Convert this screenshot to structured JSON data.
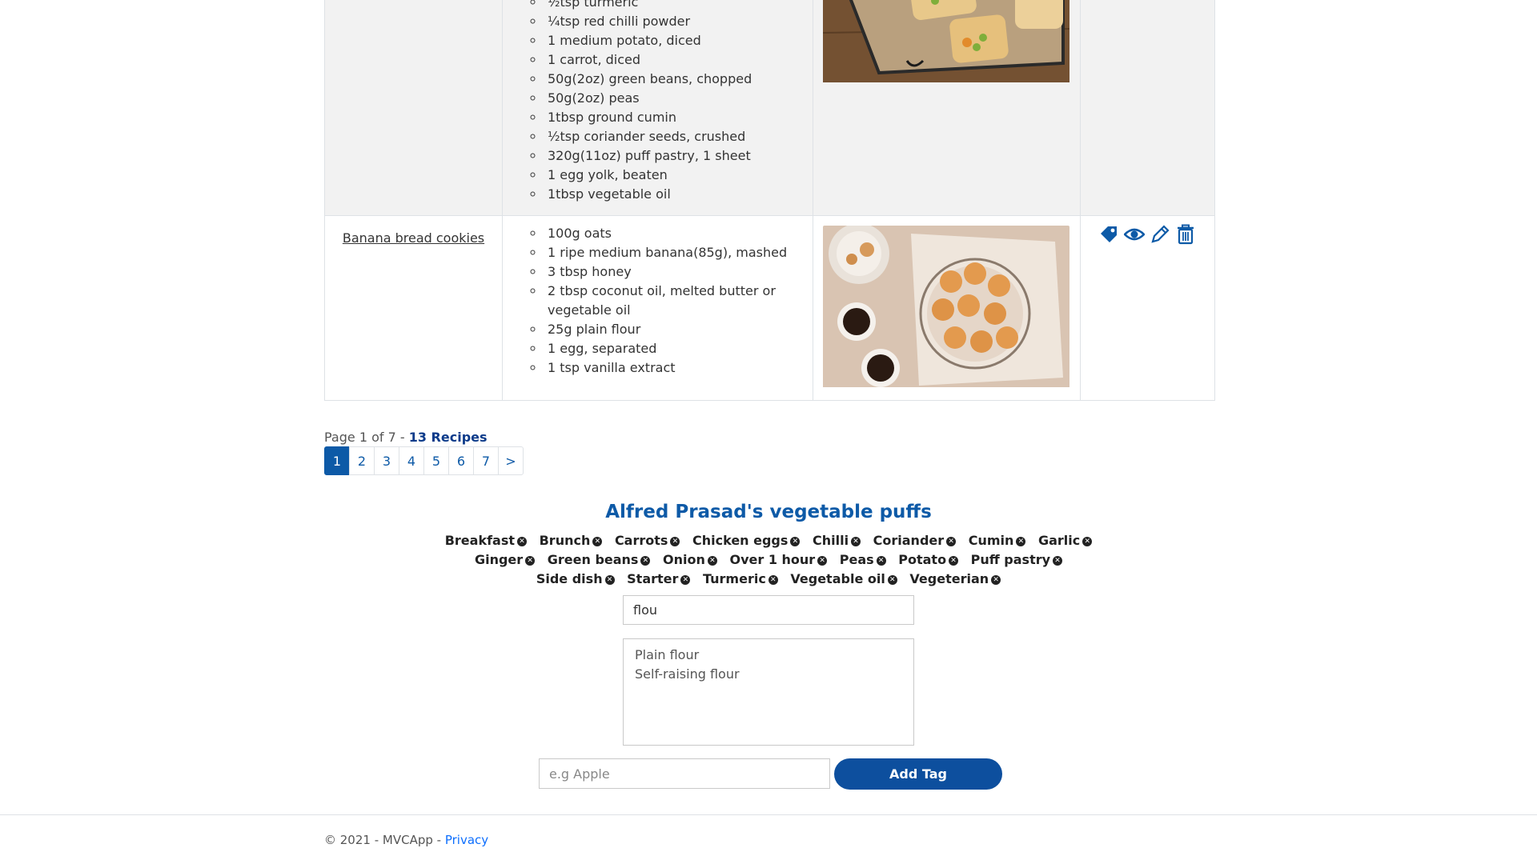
{
  "recipes_table": {
    "rows": [
      {
        "name": "",
        "ingredients": [
          "½tsp turmeric",
          "¼tsp red chilli powder",
          "1 medium potato, diced",
          "1 carrot, diced",
          "50g(2oz) green beans, chopped",
          "50g(2oz) peas",
          "1tbsp ground cumin",
          "½tsp coriander seeds, crushed",
          "320g(11oz) puff pastry, 1 sheet",
          "1 egg yolk, beaten",
          "1tbsp vegetable oil"
        ],
        "image_alt": "vegetable puffs"
      },
      {
        "name": "Banana bread cookies",
        "ingredients": [
          "100g oats",
          "1 ripe medium banana(85g), mashed",
          "3 tbsp honey",
          "2 tbsp coconut oil, melted butter or vegetable oil",
          "25g plain flour",
          "1 egg, separated",
          "1 tsp vanilla extract"
        ],
        "image_alt": "banana bread cookies",
        "actions": [
          "tag-icon",
          "eye-icon",
          "pencil-icon",
          "trash-icon"
        ]
      }
    ]
  },
  "pager": {
    "text": "Page 1 of 7 - ",
    "count": "13 Recipes",
    "pages": [
      "1",
      "2",
      "3",
      "4",
      "5",
      "6",
      "7",
      ">"
    ],
    "active_page": "1"
  },
  "recipe_title": "Alfred Prasad's vegetable puffs",
  "tags": [
    "Breakfast",
    "Brunch",
    "Carrots",
    "Chicken eggs",
    "Chilli",
    "Coriander",
    "Cumin",
    "Garlic",
    "Ginger",
    "Green beans",
    "Onion",
    "Over 1 hour",
    "Peas",
    "Potato",
    "Puff pastry",
    "Side dish",
    "Starter",
    "Turmeric",
    "Vegetable oil",
    "Vegeterian"
  ],
  "search": {
    "value": "flou"
  },
  "suggestions": [
    "Plain flour",
    "Self-raising flour"
  ],
  "new_tag": {
    "placeholder": "e.g Apple",
    "button_label": "Add Tag"
  },
  "footer": {
    "copyright": "© 2021 - MVCApp - ",
    "privacy_link": "Privacy"
  },
  "colors": {
    "accent": "#0d5aa7",
    "button": "#0d4f9e",
    "row_alt": "#f2f2f2"
  }
}
